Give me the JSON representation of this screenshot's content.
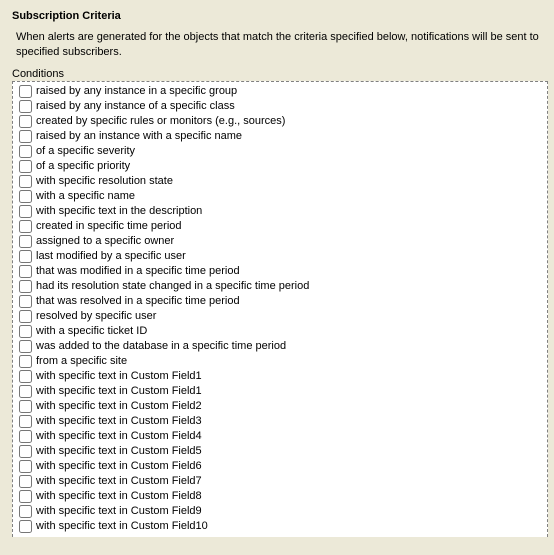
{
  "header": {
    "title": "Subscription Criteria",
    "description": "When alerts are generated for the objects that match the criteria specified below, notifications will be sent to specified subscribers."
  },
  "conditions_label": "Conditions",
  "conditions": [
    {
      "label": "raised by any instance in a specific group",
      "checked": false
    },
    {
      "label": "raised by any instance of a specific class",
      "checked": false
    },
    {
      "label": "created by specific rules or monitors (e.g., sources)",
      "checked": false
    },
    {
      "label": "raised by an instance with a specific name",
      "checked": false
    },
    {
      "label": "of a specific severity",
      "checked": false
    },
    {
      "label": "of a specific priority",
      "checked": false
    },
    {
      "label": "with specific resolution state",
      "checked": false
    },
    {
      "label": "with a specific name",
      "checked": false
    },
    {
      "label": "with specific text in the description",
      "checked": false
    },
    {
      "label": "created in specific time period",
      "checked": false
    },
    {
      "label": "assigned to a specific owner",
      "checked": false
    },
    {
      "label": "last modified by a specific user",
      "checked": false
    },
    {
      "label": "that was modified in a specific time period",
      "checked": false
    },
    {
      "label": "had its resolution state changed in a specific time period",
      "checked": false
    },
    {
      "label": "that was resolved in a specific time period",
      "checked": false
    },
    {
      "label": "resolved by specific user",
      "checked": false
    },
    {
      "label": "with a specific ticket ID",
      "checked": false
    },
    {
      "label": "was added to the database in a specific time period",
      "checked": false
    },
    {
      "label": "from a specific site",
      "checked": false
    },
    {
      "label": "with specific text in Custom Field1",
      "checked": false
    },
    {
      "label": "with specific text in Custom Field1",
      "checked": false
    },
    {
      "label": "with specific text in Custom Field2",
      "checked": false
    },
    {
      "label": "with specific text in Custom Field3",
      "checked": false
    },
    {
      "label": "with specific text in Custom Field4",
      "checked": false
    },
    {
      "label": "with specific text in Custom Field5",
      "checked": false
    },
    {
      "label": "with specific text in Custom Field6",
      "checked": false
    },
    {
      "label": "with specific text in Custom Field7",
      "checked": false
    },
    {
      "label": "with specific text in Custom Field8",
      "checked": false
    },
    {
      "label": "with specific text in Custom Field9",
      "checked": false
    },
    {
      "label": "with specific text in Custom Field10",
      "checked": false
    }
  ]
}
